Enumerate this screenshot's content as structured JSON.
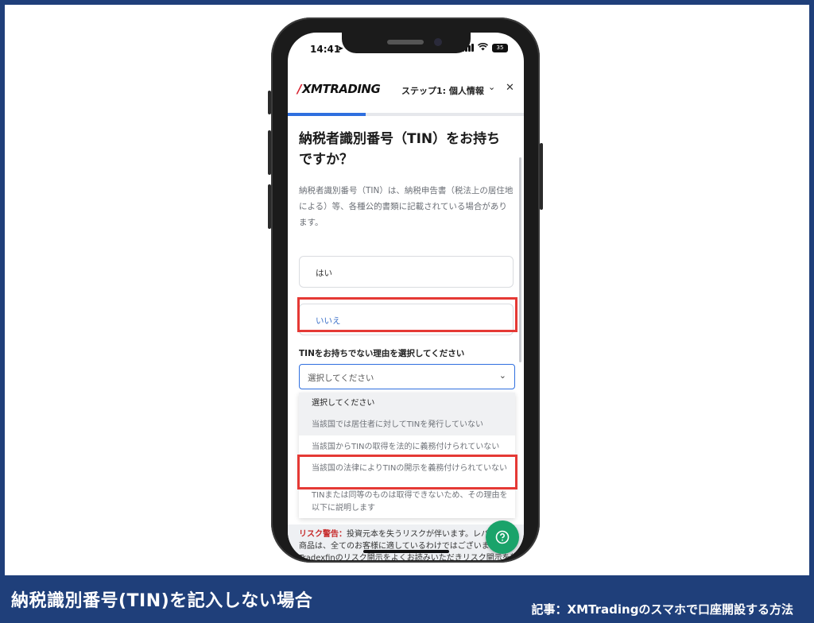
{
  "footer": {
    "title": "納税識別番号(TIN)を記入しない場合",
    "article": "記事：XMTradingのスマホで口座開設する方法"
  },
  "status_bar": {
    "time": "14:41",
    "battery": "35"
  },
  "header": {
    "logo_text": "XMTRADING",
    "step": "ステップ1: 個人情報",
    "progress": 0.33
  },
  "form": {
    "question": "納税者識別番号（TIN）をお持ちですか？",
    "description": "納税者識別番号（TIN）は、納税申告書（税法上の居住地による）等、各種公的書類に記載されている場合があります。",
    "options": {
      "yes": "はい",
      "no": "いいえ"
    },
    "select_label": "TINをお持ちでない理由を選択してください",
    "select_placeholder": "選択してください",
    "dropdown_items": [
      "選択してください",
      "当該国では居住者に対してTINを発行していない",
      "当該国からTINの取得を法的に義務付けられていない",
      "当該国の法律によりTINの開示を義務付けられていない",
      "TINまたは同等のものは取得できないため、その理由を以下に説明します"
    ]
  },
  "risk": {
    "label": "リスク警告：",
    "line1": "投資元本を失うリスクが伴います。レバ",
    "line2": "商品は、全てのお客様に適しているわけではございません",
    "line3": "Tradexfinのリスク開示をよくお読みいただきリスク開示を熟読"
  },
  "icons": {
    "close": "close-icon",
    "chevron": "chevron-down-icon",
    "help": "help-icon"
  },
  "colors": {
    "brand_blue": "#1f3f7a",
    "highlight_red": "#e53935",
    "accent_blue": "#2f6fdf",
    "help_green": "#1aa36a"
  }
}
